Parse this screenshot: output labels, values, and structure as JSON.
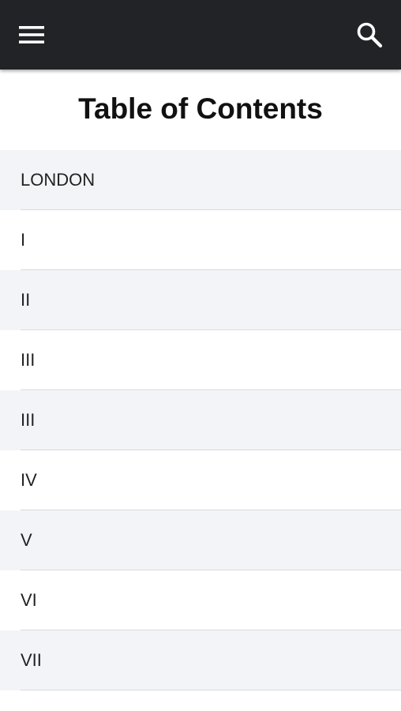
{
  "appbar": {
    "menu_icon": "hamburger-menu-icon",
    "search_icon": "search-icon",
    "background": "#222326"
  },
  "page": {
    "title": "Table of Contents"
  },
  "toc": {
    "items": [
      {
        "label": "LONDON"
      },
      {
        "label": "I"
      },
      {
        "label": "II"
      },
      {
        "label": "III"
      },
      {
        "label": "III"
      },
      {
        "label": "IV"
      },
      {
        "label": "V"
      },
      {
        "label": "VI"
      },
      {
        "label": "VII"
      }
    ]
  }
}
